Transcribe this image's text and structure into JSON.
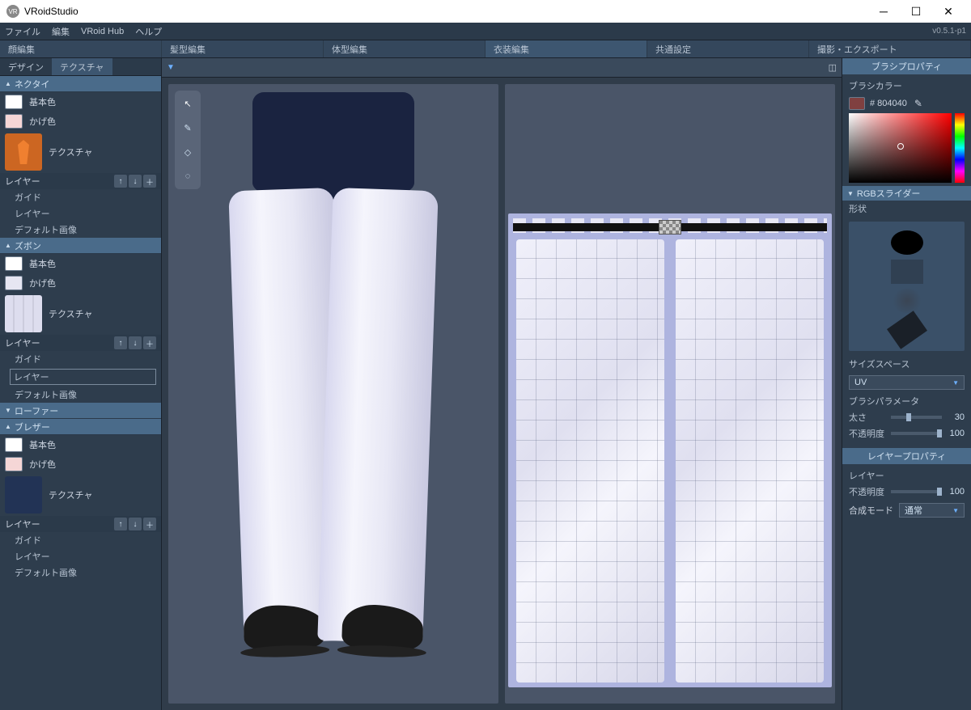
{
  "app": {
    "title": "VRoidStudio",
    "version": "v0.5.1-p1"
  },
  "menu": {
    "file": "ファイル",
    "edit": "編集",
    "hub": "VRoid Hub",
    "help": "ヘルプ"
  },
  "tabs": {
    "face": "顔編集",
    "hair": "髪型編集",
    "body": "体型編集",
    "outfit": "衣装編集",
    "common": "共通設定",
    "export": "撮影・エクスポート"
  },
  "subtabs": {
    "design": "デザイン",
    "texture": "テクスチャ"
  },
  "sections": {
    "necktie": {
      "title": "ネクタイ",
      "base": "基本色",
      "shade": "かげ色",
      "tex": "テクスチャ"
    },
    "pants": {
      "title": "ズボン",
      "base": "基本色",
      "shade": "かげ色",
      "tex": "テクスチャ"
    },
    "loafer": {
      "title": "ローファー"
    },
    "blazer": {
      "title": "ブレザー",
      "base": "基本色",
      "shade": "かげ色",
      "tex": "テクスチャ"
    }
  },
  "layers": {
    "head": "レイヤー",
    "guide": "ガイド",
    "layer": "レイヤー",
    "default": "デフォルト画像"
  },
  "brush": {
    "propPanel": "ブラシプロパティ",
    "colorLabel": "ブラシカラー",
    "colorHex": "# 804040",
    "rgbSlider": "RGBスライダー",
    "shapeLabel": "形状",
    "sizeSpace": "サイズスペース",
    "sizeSpaceVal": "UV",
    "paramsLabel": "ブラシパラメータ",
    "thickness": "太さ",
    "thicknessVal": "30",
    "opacity": "不透明度",
    "opacityVal": "100"
  },
  "layerProp": {
    "panel": "レイヤープロパティ",
    "layer": "レイヤー",
    "opacity": "不透明度",
    "opacityVal": "100",
    "blend": "合成モード",
    "blendVal": "通常"
  }
}
